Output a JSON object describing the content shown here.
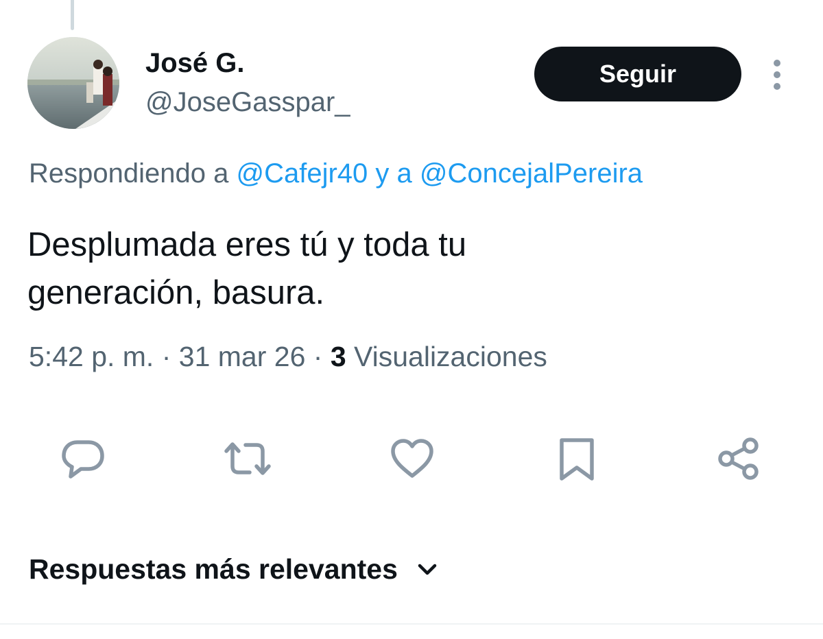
{
  "author": {
    "display_name": "José G.",
    "handle": "@JoseGasspar_"
  },
  "follow_button": {
    "label": "Seguir"
  },
  "reply_context": {
    "prefix": "Respondiendo a ",
    "mention_1": "@Cafejr40",
    "connector": " y a ",
    "mention_2": "@ConcejalPereira"
  },
  "tweet": {
    "line_1": "Desplumada eres tú y toda tu",
    "line_2": "generación, basura."
  },
  "meta": {
    "time": "5:42 p. m.",
    "separator": " · ",
    "date": "31 mar 26",
    "views_count": "3",
    "views_label": " Visualizaciones"
  },
  "actions": {
    "icons": [
      "reply-icon",
      "retweet-icon",
      "like-icon",
      "bookmark-icon",
      "share-icon"
    ]
  },
  "replies_sort": {
    "label": "Respuestas más relevantes"
  },
  "colors": {
    "text_primary": "#0f1419",
    "text_secondary": "#536471",
    "accent_blue": "#1d9bf0",
    "icon_gray": "#8b98a5",
    "divider": "#eff3f4"
  }
}
